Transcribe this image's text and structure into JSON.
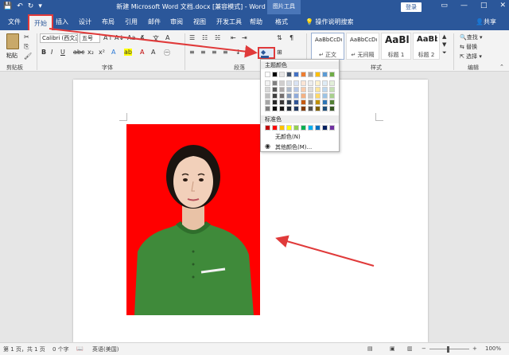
{
  "titlebar": {
    "save_icon": "save-icon",
    "undo_icon": "undo-icon",
    "doc_title": "新建 Microsoft Word 文档.docx [兼容模式] - Word",
    "context_label": "图片工具",
    "login_label": "登录"
  },
  "tabs": [
    {
      "label": "文件"
    },
    {
      "label": "开始"
    },
    {
      "label": "插入"
    },
    {
      "label": "设计"
    },
    {
      "label": "布局"
    },
    {
      "label": "引用"
    },
    {
      "label": "邮件"
    },
    {
      "label": "审阅"
    },
    {
      "label": "视图"
    },
    {
      "label": "开发工具"
    },
    {
      "label": "帮助"
    },
    {
      "label": "格式"
    }
  ],
  "tell_me": "操作说明搜索",
  "share": "共享",
  "ribbon": {
    "paste_label": "粘贴",
    "clipboard_group": "剪贴板",
    "font_name": "Calibri (西文正文)",
    "font_size": "五号",
    "font_group": "字体",
    "paragraph_group": "段落",
    "styles_group": "样式",
    "edit_group": "编辑",
    "styles": [
      {
        "sample": "AaBbCcDd",
        "name": "↵ 正文"
      },
      {
        "sample": "AaBbCcDd",
        "name": "↵ 无间隔"
      },
      {
        "sample": "AaBl",
        "name": "标题 1"
      },
      {
        "sample": "AaBbC",
        "name": "标题 2"
      }
    ],
    "find": "查找",
    "replace": "替换",
    "select": "选择"
  },
  "palette": {
    "theme_header": "主题颜色",
    "standard_header": "标准色",
    "no_color": "无颜色(N)",
    "more_colors": "其他颜色(M)...",
    "theme_top": [
      "#ffffff",
      "#000000",
      "#e7e6e6",
      "#44546a",
      "#4472c4",
      "#ed7d31",
      "#a5a5a5",
      "#ffc000",
      "#5b9bd5",
      "#70ad47"
    ],
    "theme_shades": [
      [
        "#f2f2f2",
        "#808080",
        "#d0cece",
        "#d6dce4",
        "#d9e2f3",
        "#fbe5d5",
        "#ededed",
        "#fff2cc",
        "#deebf6",
        "#e2efd9"
      ],
      [
        "#d8d8d8",
        "#595959",
        "#aeaaaa",
        "#adb9ca",
        "#b4c6e7",
        "#f7cbac",
        "#dbdbdb",
        "#fee599",
        "#bdd7ee",
        "#c5e0b3"
      ],
      [
        "#bfbfbf",
        "#3f3f3f",
        "#757070",
        "#8496b0",
        "#8eaadb",
        "#f4b183",
        "#c9c9c9",
        "#ffd965",
        "#9cc3e5",
        "#a8d08d"
      ],
      [
        "#a5a5a5",
        "#262626",
        "#3a3838",
        "#323f4f",
        "#2f5496",
        "#c55a11",
        "#7b7b7b",
        "#bf9000",
        "#2e75b5",
        "#538135"
      ],
      [
        "#7f7f7f",
        "#0d0d0d",
        "#171616",
        "#222a35",
        "#1f3864",
        "#833c0b",
        "#525252",
        "#7f6000",
        "#1e4e79",
        "#375623"
      ]
    ],
    "standard": [
      "#c00000",
      "#ff0000",
      "#ffc000",
      "#ffff00",
      "#92d050",
      "#00b050",
      "#00b0f0",
      "#0070c0",
      "#002060",
      "#7030a0"
    ]
  },
  "statusbar": {
    "page": "第 1 页，共 1 页",
    "words": "0 个字",
    "language": "英语(美国)",
    "zoom": "100%"
  },
  "colors": {
    "word_blue": "#2b579a",
    "photo_background": "#ff0000",
    "annotation_red": "#e03a3a"
  }
}
